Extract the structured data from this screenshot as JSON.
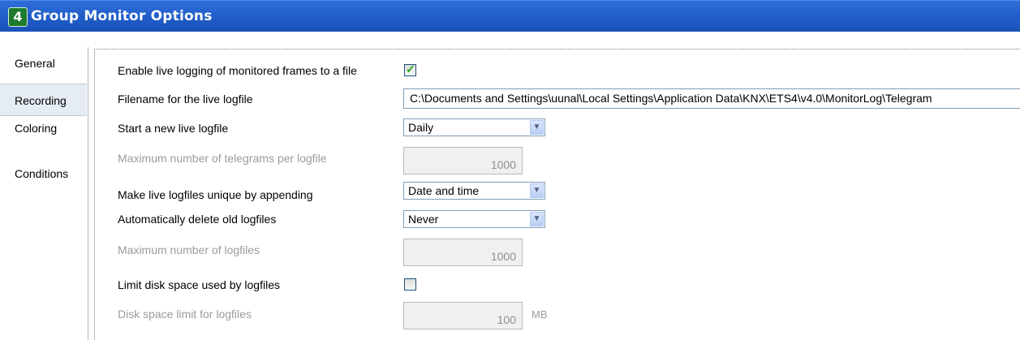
{
  "window": {
    "title": "Group Monitor Options",
    "icon": "ets4-app-icon",
    "icon_glyph": "4"
  },
  "sidebar": {
    "items": [
      {
        "label": "General",
        "selected": false
      },
      {
        "label": "Recording",
        "selected": true
      },
      {
        "label": "Coloring",
        "selected": false
      },
      {
        "label": "Conditions",
        "selected": false
      }
    ]
  },
  "recording": {
    "enable_live_logging": {
      "label": "Enable live logging of monitored frames to a file",
      "checked": true
    },
    "filename": {
      "label": "Filename for the live logfile",
      "value": "C:\\Documents and Settings\\uunal\\Local Settings\\Application Data\\KNX\\ETS4\\v4.0\\MonitorLog\\Telegram"
    },
    "start_new": {
      "label": "Start a new live logfile",
      "value": "Daily"
    },
    "max_telegrams": {
      "label": "Maximum number of telegrams per logfile",
      "value": "1000",
      "enabled": false
    },
    "unique_append": {
      "label": "Make live logfiles unique by appending",
      "value": "Date and time"
    },
    "auto_delete": {
      "label": "Automatically delete old logfiles",
      "value": "Never"
    },
    "max_logfiles": {
      "label": "Maximum number of logfiles",
      "value": "1000",
      "enabled": false
    },
    "limit_disk": {
      "label": "Limit disk space used by logfiles",
      "checked": false
    },
    "disk_limit": {
      "label": "Disk space limit for logfiles",
      "value": "100",
      "unit": "MB",
      "enabled": false
    }
  },
  "icons": {
    "dropdown": "chevron-down-icon",
    "check": "checkmark-icon"
  }
}
